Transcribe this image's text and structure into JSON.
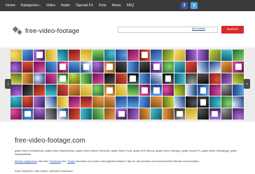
{
  "nav": {
    "items": [
      {
        "label": "Home",
        "dropdown": false
      },
      {
        "label": "Kategorien",
        "dropdown": true
      },
      {
        "label": "Video",
        "dropdown": false
      },
      {
        "label": "Audio",
        "dropdown": false
      },
      {
        "label": "Special FX",
        "dropdown": false
      },
      {
        "label": "Foto",
        "dropdown": false
      },
      {
        "label": "News",
        "dropdown": false
      },
      {
        "label": "FAQ",
        "dropdown": false
      }
    ],
    "caret": "▾",
    "social": {
      "facebook": "f",
      "twitter": "t"
    }
  },
  "header": {
    "logo_text": "free-video-footage",
    "search": {
      "placeholder": "",
      "select_label": "Alle Dateien",
      "button_label": "Suchen"
    }
  },
  "gallery": {
    "prev_glyph": "‹",
    "next_glyph": "›"
  },
  "content": {
    "title": "free-video-footage.com",
    "p1": "gratis Video Hintergründe, gratis Video Bauchbinden, gratis Video Motion Elements, gratis Video Fonts, gratis DVD Menüs, gratis Video Overlays, gratis Sound FX, gratis Video Übergänge, gratis Spezialeffekte.",
    "p2_link1": "Einfach registrieren",
    "p2_text1": " oder über ",
    "p2_link2": "Facebook",
    "p2_text2": " bzw. ",
    "p2_link3": "Twitter",
    "p2_text3": " anmelden und unsere lizenzgebührenfreien Clips für den privaten und kommerziellen Einsatz herunterladen.",
    "p3": "Keine Spielchen, kein Haken, unlimited Download !"
  },
  "colors": {
    "nav_bg": "#3a3a3a",
    "search_button": "#d62b2b",
    "link": "#2a5db0",
    "facebook": "#3b5998",
    "twitter": "#4aa7e0"
  }
}
